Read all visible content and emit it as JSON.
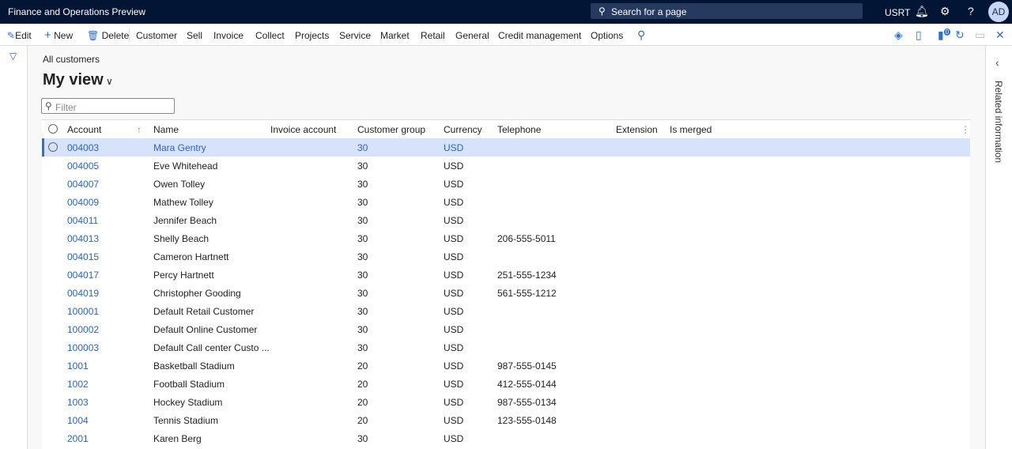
{
  "app": {
    "title": "Finance and Operations Preview",
    "search_placeholder": "Search for a page",
    "company": "USRT",
    "avatar": "AD",
    "badge": "0"
  },
  "toolbar": {
    "edit": "Edit",
    "new": "New",
    "delete": "Delete",
    "menus": [
      "Customer",
      "Sell",
      "Invoice",
      "Collect",
      "Projects",
      "Service",
      "Market",
      "Retail",
      "General",
      "Credit management",
      "Options"
    ]
  },
  "page": {
    "breadcrumb": "All customers",
    "view": "My view",
    "filter_placeholder": "Filter",
    "related": "Related information"
  },
  "columns": [
    "Account",
    "Name",
    "Invoice account",
    "Customer group",
    "Currency",
    "Telephone",
    "Extension",
    "Is merged"
  ],
  "rows": [
    [
      "004003",
      "Mara Gentry",
      "",
      "30",
      "USD",
      ""
    ],
    [
      "004005",
      "Eve Whitehead",
      "",
      "30",
      "USD",
      ""
    ],
    [
      "004007",
      "Owen  Tolley",
      "",
      "30",
      "USD",
      ""
    ],
    [
      "004009",
      "Mathew Tolley",
      "",
      "30",
      "USD",
      ""
    ],
    [
      "004011",
      "Jennifer Beach",
      "",
      "30",
      "USD",
      ""
    ],
    [
      "004013",
      "Shelly Beach",
      "",
      "30",
      "USD",
      "206-555-5011"
    ],
    [
      "004015",
      "Cameron Hartnett",
      "",
      "30",
      "USD",
      ""
    ],
    [
      "004017",
      "Percy Hartnett",
      "",
      "30",
      "USD",
      "251-555-1234"
    ],
    [
      "004019",
      "Christopher Gooding",
      "",
      "30",
      "USD",
      "561-555-1212"
    ],
    [
      "100001",
      "Default Retail Customer",
      "",
      "30",
      "USD",
      ""
    ],
    [
      "100002",
      "Default Online Customer",
      "",
      "30",
      "USD",
      ""
    ],
    [
      "100003",
      "Default Call center Custo ...",
      "",
      "30",
      "USD",
      ""
    ],
    [
      "1001",
      "Basketball Stadium",
      "",
      "20",
      "USD",
      "987-555-0145"
    ],
    [
      "1002",
      "Football Stadium",
      "",
      "20",
      "USD",
      "412-555-0144"
    ],
    [
      "1003",
      "Hockey Stadium",
      "",
      "20",
      "USD",
      "987-555-0134"
    ],
    [
      "1004",
      "Tennis Stadium",
      "",
      "20",
      "USD",
      "123-555-0148"
    ],
    [
      "2001",
      "Karen Berg",
      "",
      "30",
      "USD",
      ""
    ]
  ]
}
